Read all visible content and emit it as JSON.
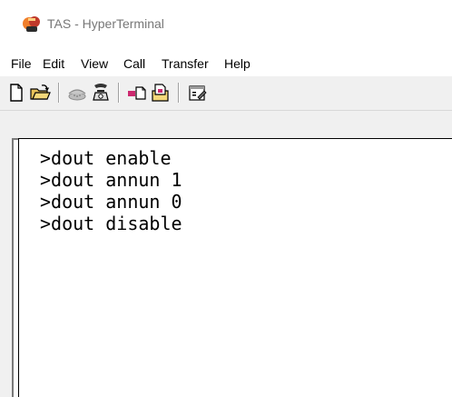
{
  "window": {
    "title": "TAS - HyperTerminal",
    "icon": "hyperterminal-app-icon"
  },
  "menu": {
    "items": [
      {
        "label": "File"
      },
      {
        "label": "Edit"
      },
      {
        "label": "View"
      },
      {
        "label": "Call"
      },
      {
        "label": "Transfer"
      },
      {
        "label": "Help"
      }
    ]
  },
  "toolbar": {
    "buttons": [
      {
        "icon": "new-document-icon"
      },
      {
        "icon": "open-folder-icon"
      },
      {
        "icon": "connect-phone-icon"
      },
      {
        "icon": "disconnect-phone-icon"
      },
      {
        "icon": "send-file-icon"
      },
      {
        "icon": "receive-file-icon"
      },
      {
        "icon": "properties-icon"
      }
    ]
  },
  "terminal": {
    "lines": [
      ">dout enable",
      ">dout annun 1",
      ">dout annun 0",
      ">dout disable"
    ]
  },
  "colors": {
    "toolbar_bg": "#f0f0f0",
    "terminal_bg": "#ffffff",
    "terminal_text": "#000000",
    "title_text": "#777777"
  }
}
